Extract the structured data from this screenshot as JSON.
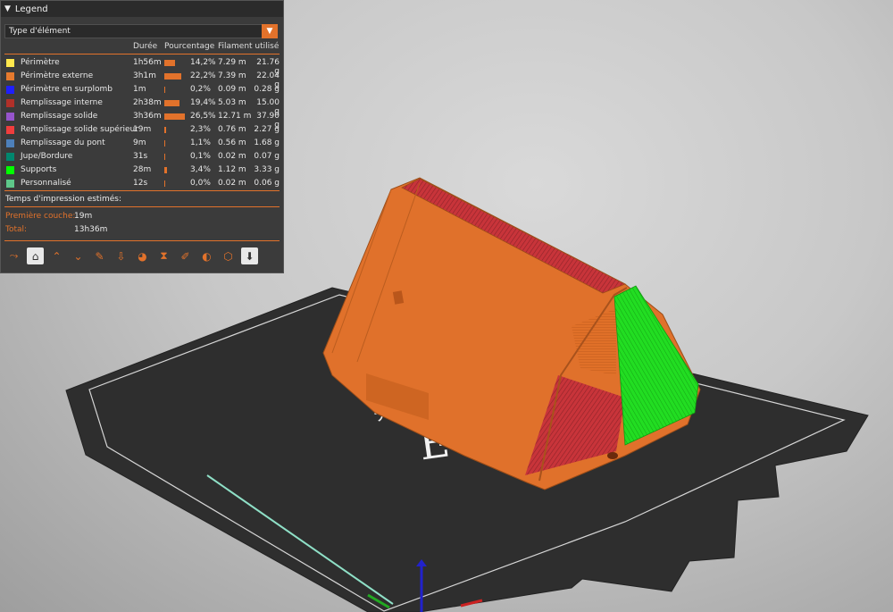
{
  "legend": {
    "title": "Legend",
    "view_type": "Type d'élément",
    "columns": {
      "duration": "Durée",
      "percent": "Pourcentage",
      "filament": "Filament utilisé"
    },
    "rows": [
      {
        "name": "Périmètre",
        "color": "#FFE84D",
        "duration": "1h56m",
        "percent_value": 14.2,
        "percent": "14,2%",
        "length": "7.29 m",
        "weight": "21.76 g"
      },
      {
        "name": "Périmètre externe",
        "color": "#E67A2E",
        "duration": "3h1m",
        "percent_value": 22.2,
        "percent": "22,2%",
        "length": "7.39 m",
        "weight": "22.04 g"
      },
      {
        "name": "Périmètre en surplomb",
        "color": "#1F1FFF",
        "duration": "1m",
        "percent_value": 0.2,
        "percent": "0,2%",
        "length": "0.09 m",
        "weight": "0.28 g"
      },
      {
        "name": "Remplissage interne",
        "color": "#B03029",
        "duration": "2h38m",
        "percent_value": 19.4,
        "percent": "19,4%",
        "length": "5.03 m",
        "weight": "15.00 g"
      },
      {
        "name": "Remplissage solide",
        "color": "#9654CC",
        "duration": "3h36m",
        "percent_value": 26.5,
        "percent": "26,5%",
        "length": "12.71 m",
        "weight": "37.90 g"
      },
      {
        "name": "Remplissage solide supérieur",
        "color": "#F03D3D",
        "duration": "19m",
        "percent_value": 2.3,
        "percent": "2,3%",
        "length": "0.76 m",
        "weight": "2.27 g"
      },
      {
        "name": "Remplissage du pont",
        "color": "#4D80BA",
        "duration": "9m",
        "percent_value": 1.1,
        "percent": "1,1%",
        "length": "0.56 m",
        "weight": "1.68 g"
      },
      {
        "name": "Jupe/Bordure",
        "color": "#00876E",
        "duration": "31s",
        "percent_value": 0.1,
        "percent": "0,1%",
        "length": "0.02 m",
        "weight": "0.07 g"
      },
      {
        "name": "Supports",
        "color": "#00FF00",
        "duration": "28m",
        "percent_value": 3.4,
        "percent": "3,4%",
        "length": "1.12 m",
        "weight": "3.33 g"
      },
      {
        "name": "Personnalisé",
        "color": "#5EC88A",
        "duration": "12s",
        "percent_value": 0.0,
        "percent": "0,0%",
        "length": "0.02 m",
        "weight": "0.06 g"
      }
    ],
    "estimates_title": "Temps d'impression estimés:",
    "first_layer_label": "Première couche:",
    "first_layer_value": "19m",
    "total_label": "Total:",
    "total_value": "13h36m",
    "toolbar": [
      {
        "icon": "travel-icon",
        "glyph": "⤳",
        "active": false
      },
      {
        "icon": "wipe-icon",
        "glyph": "⌂",
        "active": true
      },
      {
        "icon": "retractions-icon",
        "glyph": "⌃",
        "active": false
      },
      {
        "icon": "deretractions-icon",
        "glyph": "⌄",
        "active": false
      },
      {
        "icon": "seams-icon",
        "glyph": "✎",
        "active": false
      },
      {
        "icon": "tool-changes-icon",
        "glyph": "⇩",
        "active": false
      },
      {
        "icon": "color-changes-icon",
        "glyph": "◕",
        "active": false
      },
      {
        "icon": "pause-prints-icon",
        "glyph": "⧗",
        "active": false
      },
      {
        "icon": "custom-gcodes-icon",
        "glyph": "✐",
        "active": false
      },
      {
        "icon": "center-of-gravity-icon",
        "glyph": "◐",
        "active": false
      },
      {
        "icon": "shells-icon",
        "glyph": "⬡",
        "active": false
      },
      {
        "icon": "tool-marker-icon",
        "glyph": "⬇",
        "active": true
      }
    ]
  },
  "scene": {
    "bed_color": "#2f2f2f",
    "model_color": "#E2722B",
    "support_color": "#1ED81E",
    "infill_color": "#C8343A"
  }
}
